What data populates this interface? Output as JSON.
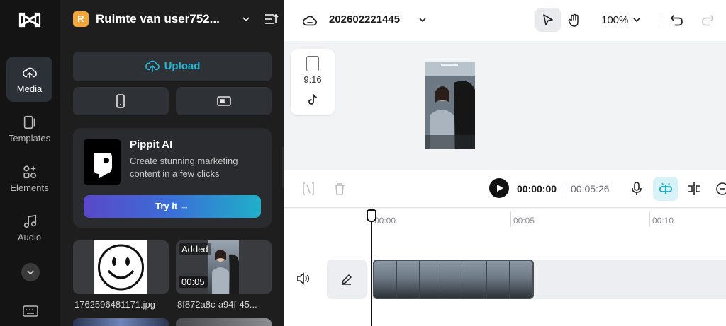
{
  "rail": {
    "items": [
      {
        "label": "Media",
        "icon": "cloud-upload-icon",
        "active": true
      },
      {
        "label": "Templates",
        "icon": "templates-icon"
      },
      {
        "label": "Elements",
        "icon": "elements-icon"
      },
      {
        "label": "Audio",
        "icon": "music-note-icon"
      }
    ]
  },
  "panel": {
    "workspace_badge": "R",
    "workspace_name": "Ruimte van user752...",
    "upload_label": "Upload",
    "promo": {
      "title": "Pippit AI",
      "description": "Create stunning marketing content in a few clicks",
      "cta": "Try it →"
    },
    "media": [
      {
        "filename": "1762596481171.jpg"
      },
      {
        "filename": "8f872a8c-a94f-45...",
        "added_label": "Added",
        "duration": "00:05"
      }
    ]
  },
  "topbar": {
    "project_name": "202602221445",
    "zoom": "100%"
  },
  "canvas": {
    "aspect_ratio": "9:16"
  },
  "controls": {
    "current_time": "00:00:00",
    "total_time": "00:05:26"
  },
  "timeline": {
    "ticks": [
      "00:00",
      "00:05",
      "00:10"
    ]
  },
  "colors": {
    "accent": "#22b8d6",
    "rail_bg": "#141414",
    "panel_bg": "#1e1e1f",
    "workspace_badge": "#f2a73b"
  }
}
